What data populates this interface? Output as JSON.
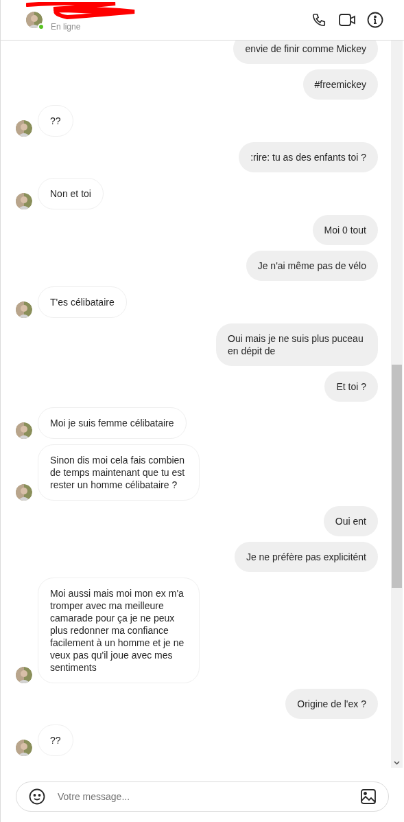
{
  "header": {
    "status": "En ligne",
    "online": true
  },
  "messages": [
    {
      "kind": "sent",
      "text": "envie de finir comme Mickey"
    },
    {
      "kind": "sent",
      "text": "#freemickey"
    },
    {
      "kind": "received",
      "text": "??"
    },
    {
      "kind": "sent",
      "text": ":rire: tu as des enfants toi ?"
    },
    {
      "kind": "received",
      "text": "Non et toi"
    },
    {
      "kind": "sent",
      "text": "Moi 0 tout"
    },
    {
      "kind": "sent",
      "text": "Je n'ai même pas de vélo"
    },
    {
      "kind": "received",
      "text": "T'es célibataire"
    },
    {
      "kind": "sent",
      "text": "Oui mais je ne suis plus puceau en dépit de"
    },
    {
      "kind": "sent",
      "text": "Et toi ?"
    },
    {
      "kind": "received",
      "text": "Moi je suis femme célibataire"
    },
    {
      "kind": "received",
      "text": "Sinon dis moi cela fais combien de temps maintenant que tu est rester un homme célibataire ?"
    },
    {
      "kind": "sent",
      "text": "Oui ent"
    },
    {
      "kind": "sent",
      "text": "Je ne préfère pas explicitént"
    },
    {
      "kind": "received",
      "text": "Moi aussi mais moi mon ex m'a tromper avec ma meilleure camarade pour ça je ne peux plus redonner ma confiance facilement à un homme et je ne veux pas qu'il joue avec mes sentiments"
    },
    {
      "kind": "sent",
      "text": "Origine de l'ex ?"
    },
    {
      "kind": "received",
      "text": "??"
    }
  ],
  "composer": {
    "placeholder": "Votre message..."
  }
}
